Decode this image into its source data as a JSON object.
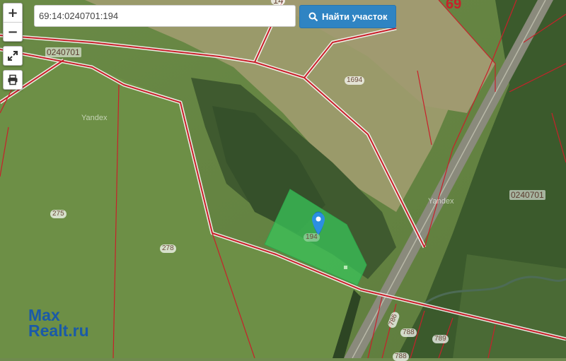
{
  "controls": {
    "zoom_in_label": "+",
    "zoom_out_label": "−"
  },
  "search": {
    "value": "69:14:0240701:194",
    "button_label": "Найти участок"
  },
  "map": {
    "region_label": "69",
    "top_cut_label": "14",
    "quarter_labels": [
      "0240701",
      "0240701"
    ],
    "parcel_labels": [
      "1694",
      "275",
      "278",
      "194",
      "786",
      "788",
      "789",
      "788"
    ],
    "yandex_labels": [
      "Yandex",
      "Yandex"
    ],
    "highlight_color": "#39c45a",
    "boundary_color": "#c8202a"
  },
  "logo": {
    "line1": "Max",
    "line2": "Realt.ru"
  }
}
